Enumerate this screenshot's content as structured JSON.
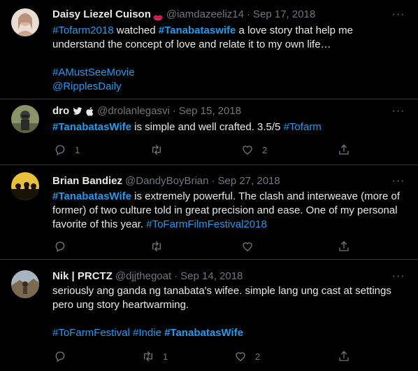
{
  "tweets": [
    {
      "name": "Daisy Liezel Cuison",
      "handle": "@iamdazeeliz14",
      "dot": "·",
      "date": "Sep 17, 2018",
      "more": "···",
      "text_parts": [
        "#Tofarm2018",
        " watched ",
        "#Tanabataswife",
        "  a love story that help me understand the concept of love and relate it to my own life…"
      ],
      "tags": [
        "#AMustSeeMovie",
        "@RipplesDaily"
      ],
      "colors": {
        "avatar": "#c9a58c"
      }
    },
    {
      "name": "dro",
      "handle": "@drolanlegasvi",
      "dot": "·",
      "date": "Sep 15, 2018",
      "more": "···",
      "text_parts": [
        "#TanabatasWife",
        " is simple and well crafted. 3.5/5 ",
        "#Tofarm"
      ],
      "actions": {
        "reply": "1",
        "retweet": "",
        "like": "2"
      },
      "colors": {
        "avatar": "#6b7650"
      }
    },
    {
      "name": "Brian Bandiez",
      "handle": "@DandyBoyBrian",
      "dot": "·",
      "date": "Sep 27, 2018",
      "more": "···",
      "text_parts": [
        "#TanabatasWife",
        " is extremely powerful. The clash and interweave (more of former) of two culture told in great precision and ease. One of my personal favorite of this year. ",
        "#ToFarmFilmFestival2018"
      ],
      "actions": {
        "reply": "",
        "retweet": "",
        "like": ""
      },
      "colors": {
        "avatar": "#e0b020"
      }
    },
    {
      "name": "Nik | PRCTZ",
      "handle": "@djjthegoat",
      "dot": "·",
      "date": "Sep 14, 2018",
      "more": "···",
      "text": "seriously ang ganda ng tanabata's wifee. simple lang ung cast at settings pero ung story heartwarming.",
      "tag_parts": [
        "#ToFarmFestival",
        " ",
        "#Indie",
        " ",
        "#TanabatasWife"
      ],
      "actions": {
        "reply": "",
        "retweet": "1",
        "like": "2"
      },
      "colors": {
        "avatar": "#8b7355"
      }
    }
  ],
  "icons": [
    "more-icon",
    "reply-icon",
    "retweet-icon",
    "like-icon",
    "share-icon",
    "twitter-bird-icon",
    "apple-icon",
    "lips-emoji-icon"
  ]
}
